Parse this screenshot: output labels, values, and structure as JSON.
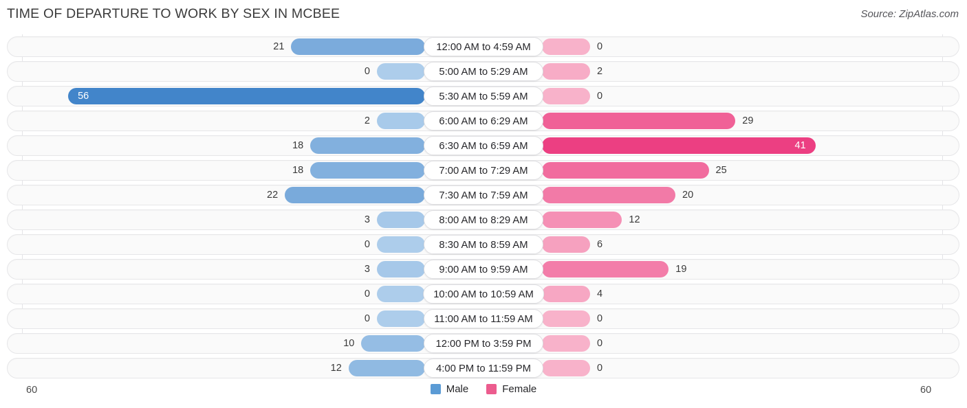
{
  "header": {
    "title": "TIME OF DEPARTURE TO WORK BY SEX IN MCBEE",
    "source": "Source: ZipAtlas.com"
  },
  "axis": {
    "left_max": "60",
    "right_max": "60"
  },
  "legend": {
    "items": [
      {
        "label": "Male",
        "color": "#5b9bd5"
      },
      {
        "label": "Female",
        "color": "#ec5c8e"
      }
    ]
  },
  "chart_data": {
    "type": "bar",
    "subtype": "diverging-horizontal-bar",
    "title": "TIME OF DEPARTURE TO WORK BY SEX IN MCBEE",
    "xlabel": "",
    "ylabel": "",
    "xlim": [
      60,
      60
    ],
    "grid": true,
    "legend_position": "bottom-center",
    "categories": [
      "12:00 AM to 4:59 AM",
      "5:00 AM to 5:29 AM",
      "5:30 AM to 5:59 AM",
      "6:00 AM to 6:29 AM",
      "6:30 AM to 6:59 AM",
      "7:00 AM to 7:29 AM",
      "7:30 AM to 7:59 AM",
      "8:00 AM to 8:29 AM",
      "8:30 AM to 8:59 AM",
      "9:00 AM to 9:59 AM",
      "10:00 AM to 10:59 AM",
      "11:00 AM to 11:59 AM",
      "12:00 PM to 3:59 PM",
      "4:00 PM to 11:59 PM"
    ],
    "series": [
      {
        "name": "Male",
        "color": "#5b9bd5",
        "direction": "left",
        "values": [
          21,
          0,
          56,
          2,
          18,
          18,
          22,
          3,
          0,
          3,
          0,
          0,
          10,
          12
        ]
      },
      {
        "name": "Female",
        "color": "#ec5c8e",
        "direction": "right",
        "values": [
          0,
          2,
          0,
          29,
          41,
          25,
          20,
          12,
          6,
          19,
          4,
          0,
          0,
          0
        ]
      }
    ]
  }
}
